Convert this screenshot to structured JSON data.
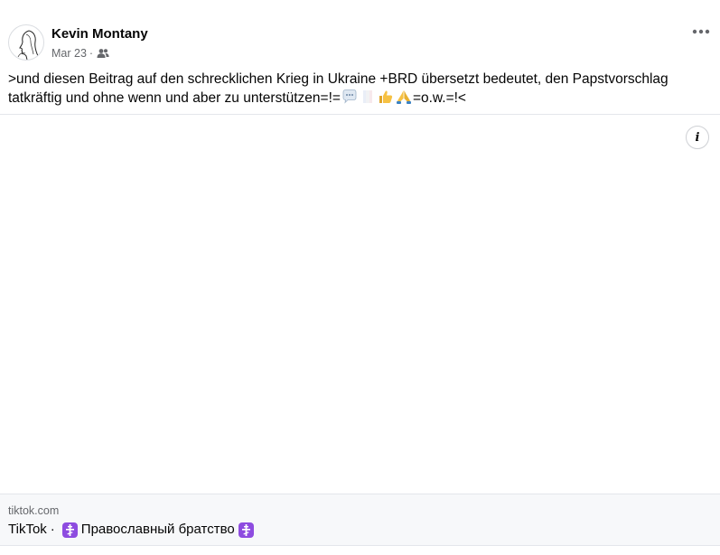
{
  "post": {
    "author": "Kevin Montany",
    "date": "Mar 23",
    "separator": "·",
    "audience_icon": "friends-icon",
    "text_part1": ">und diesen Beitrag auf den schrecklichen Krieg in Ukraine +BRD übersetzt bedeutet, den Papstvorschlag tatkräftig und ohne wenn und aber zu unterstützen=!=",
    "text_part2": "=o.w.=!<",
    "emojis": [
      "speech-bubble-icon",
      "flag-icon",
      "thumbs-up-icon",
      "folded-hands-icon"
    ]
  },
  "link_preview": {
    "domain": "tiktok.com",
    "site": "TikTok",
    "separator": "·",
    "title": "Православный братство"
  },
  "colors": {
    "text": "#050505",
    "secondary": "#65676b",
    "preview_bg": "#f7f8fa",
    "cross_badge": "#8e4ce0"
  }
}
